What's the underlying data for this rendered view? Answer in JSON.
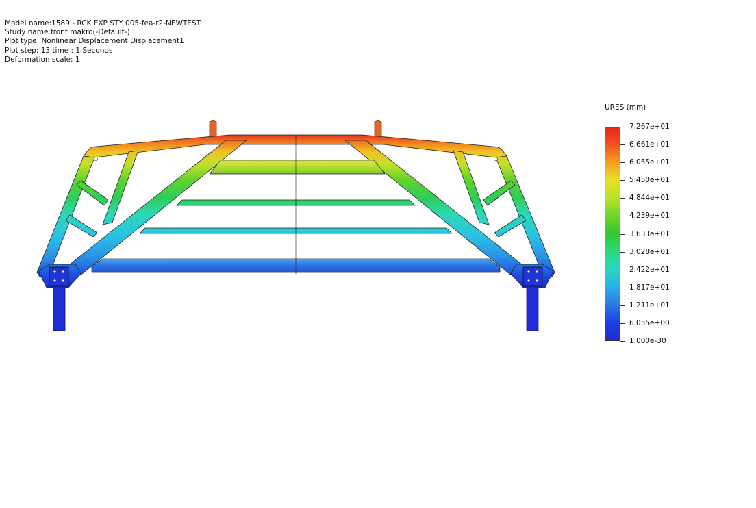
{
  "header": {
    "model_name": "Model name:1589 - RCK EXP STY 005-fea-r2-NEWTEST",
    "study_name": "Study name:front makro(-Default-)",
    "plot_type": "Plot type: Nonlinear Displacement Displacement1",
    "plot_step": "Plot step: 13   time : 1 Seconds",
    "deformation_scale": "Deformation scale: 1"
  },
  "legend": {
    "title": "URES (mm)",
    "labels": [
      "7.267e+01",
      "6.661e+01",
      "6.055e+01",
      "5.450e+01",
      "4.844e+01",
      "4.239e+01",
      "3.633e+01",
      "3.028e+01",
      "2.422e+01",
      "1.817e+01",
      "1.211e+01",
      "6.055e+00",
      "1.000e-30"
    ],
    "colors": [
      "#e8231a",
      "#f2551f",
      "#f5a121",
      "#e8e025",
      "#b6e32a",
      "#6ed42c",
      "#33c830",
      "#2ad880",
      "#2bd6c4",
      "#2bb0e8",
      "#2a78e3",
      "#1e3fe0",
      "#1f2bd6"
    ]
  }
}
